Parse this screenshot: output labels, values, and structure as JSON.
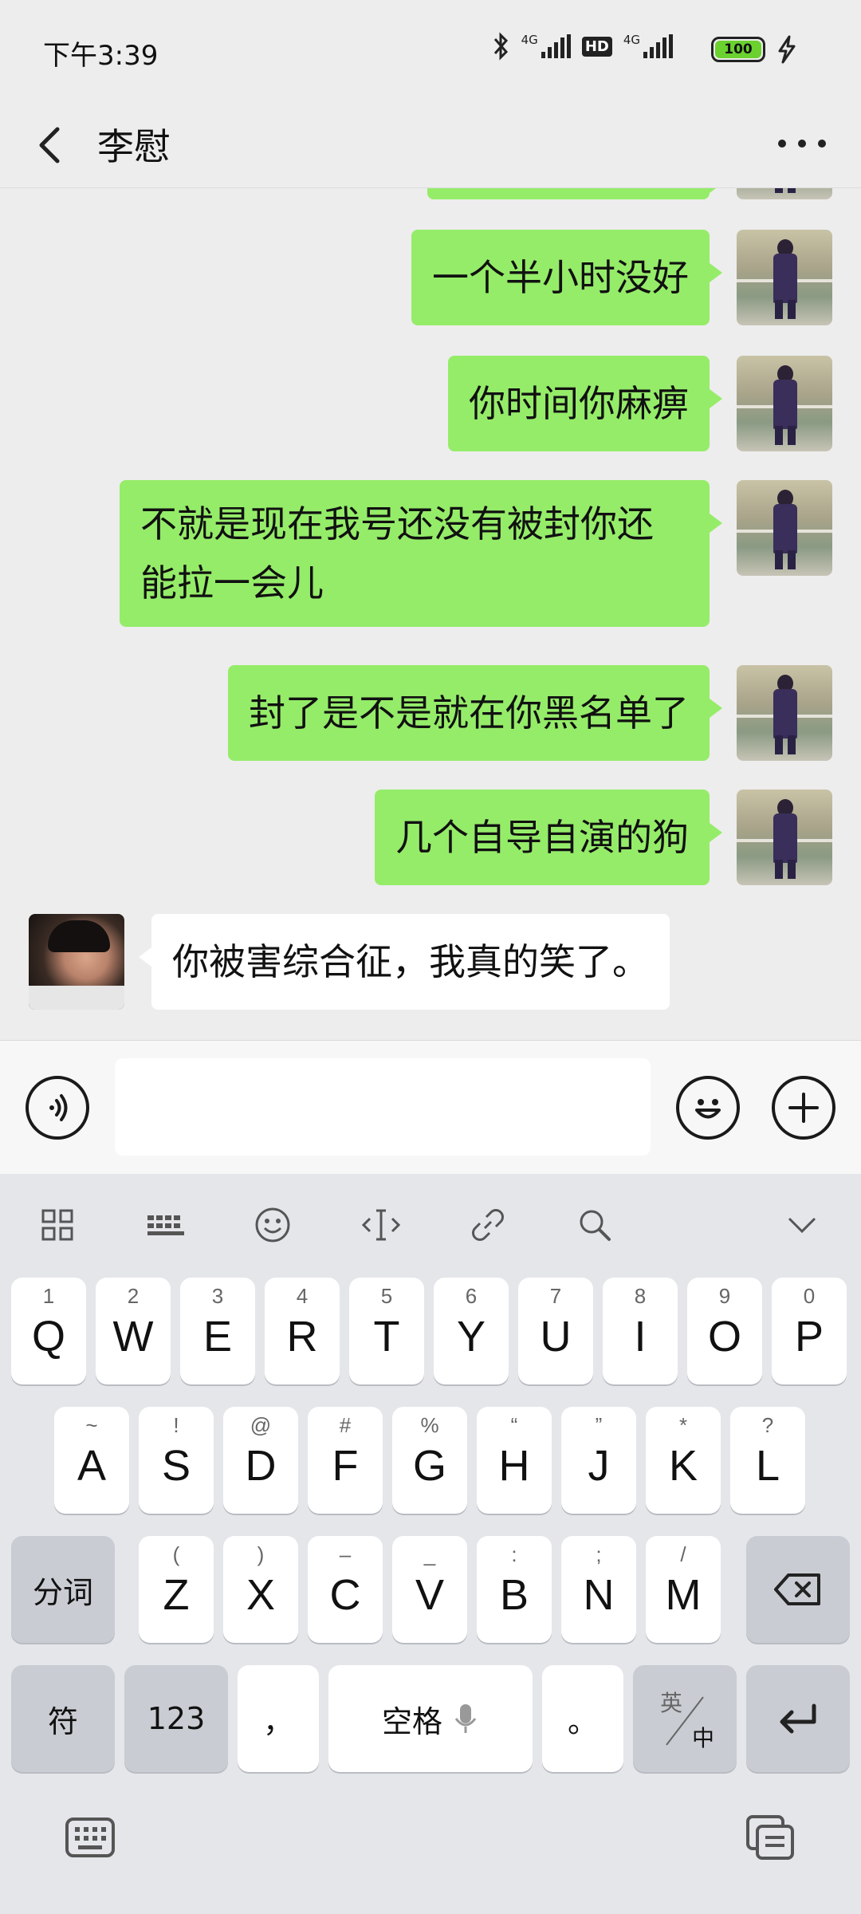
{
  "status_bar": {
    "time": "下午3:39",
    "net1": "4G",
    "hd": "HD",
    "net2": "4G",
    "battery": "100"
  },
  "header": {
    "title": "李慰"
  },
  "messages": [
    {
      "from": "me",
      "text": ""
    },
    {
      "from": "me",
      "text": "一个半小时没好"
    },
    {
      "from": "me",
      "text": "你时间你麻痹"
    },
    {
      "from": "me",
      "text": "不就是现在我号还没有被封你还\n能拉一会儿"
    },
    {
      "from": "me",
      "text": "封了是不是就在你黑名单了"
    },
    {
      "from": "me",
      "text": "几个自导自演的狗"
    },
    {
      "from": "them",
      "text": "你被害综合征，我真的笑了。"
    }
  ],
  "input": {
    "value": "",
    "placeholder": ""
  },
  "keyboard": {
    "row1": [
      {
        "hint": "1",
        "key": "Q"
      },
      {
        "hint": "2",
        "key": "W"
      },
      {
        "hint": "3",
        "key": "E"
      },
      {
        "hint": "4",
        "key": "R"
      },
      {
        "hint": "5",
        "key": "T"
      },
      {
        "hint": "6",
        "key": "Y"
      },
      {
        "hint": "7",
        "key": "U"
      },
      {
        "hint": "8",
        "key": "I"
      },
      {
        "hint": "9",
        "key": "O"
      },
      {
        "hint": "0",
        "key": "P"
      }
    ],
    "row2": [
      {
        "hint": "~",
        "key": "A"
      },
      {
        "hint": "!",
        "key": "S"
      },
      {
        "hint": "@",
        "key": "D"
      },
      {
        "hint": "#",
        "key": "F"
      },
      {
        "hint": "%",
        "key": "G"
      },
      {
        "hint": "“",
        "key": "H"
      },
      {
        "hint": "”",
        "key": "J"
      },
      {
        "hint": "*",
        "key": "K"
      },
      {
        "hint": "?",
        "key": "L"
      }
    ],
    "row3": [
      {
        "hint": "(",
        "key": "Z"
      },
      {
        "hint": ")",
        "key": "X"
      },
      {
        "hint": "–",
        "key": "C"
      },
      {
        "hint": "_",
        "key": "V"
      },
      {
        "hint": ":",
        "key": "B"
      },
      {
        "hint": ";",
        "key": "N"
      },
      {
        "hint": "/",
        "key": "M"
      }
    ],
    "segment_label": "分词",
    "symbol_label": "符",
    "num_label": "123",
    "comma_label": "，",
    "space_label": "空格",
    "period_label": "。",
    "lang_top": "英",
    "lang_bottom": "中"
  },
  "colors": {
    "my_bubble": "#95ec69",
    "their_bubble": "#ffffff",
    "background": "#ededed",
    "keyboard_bg": "#e4e6ea"
  }
}
